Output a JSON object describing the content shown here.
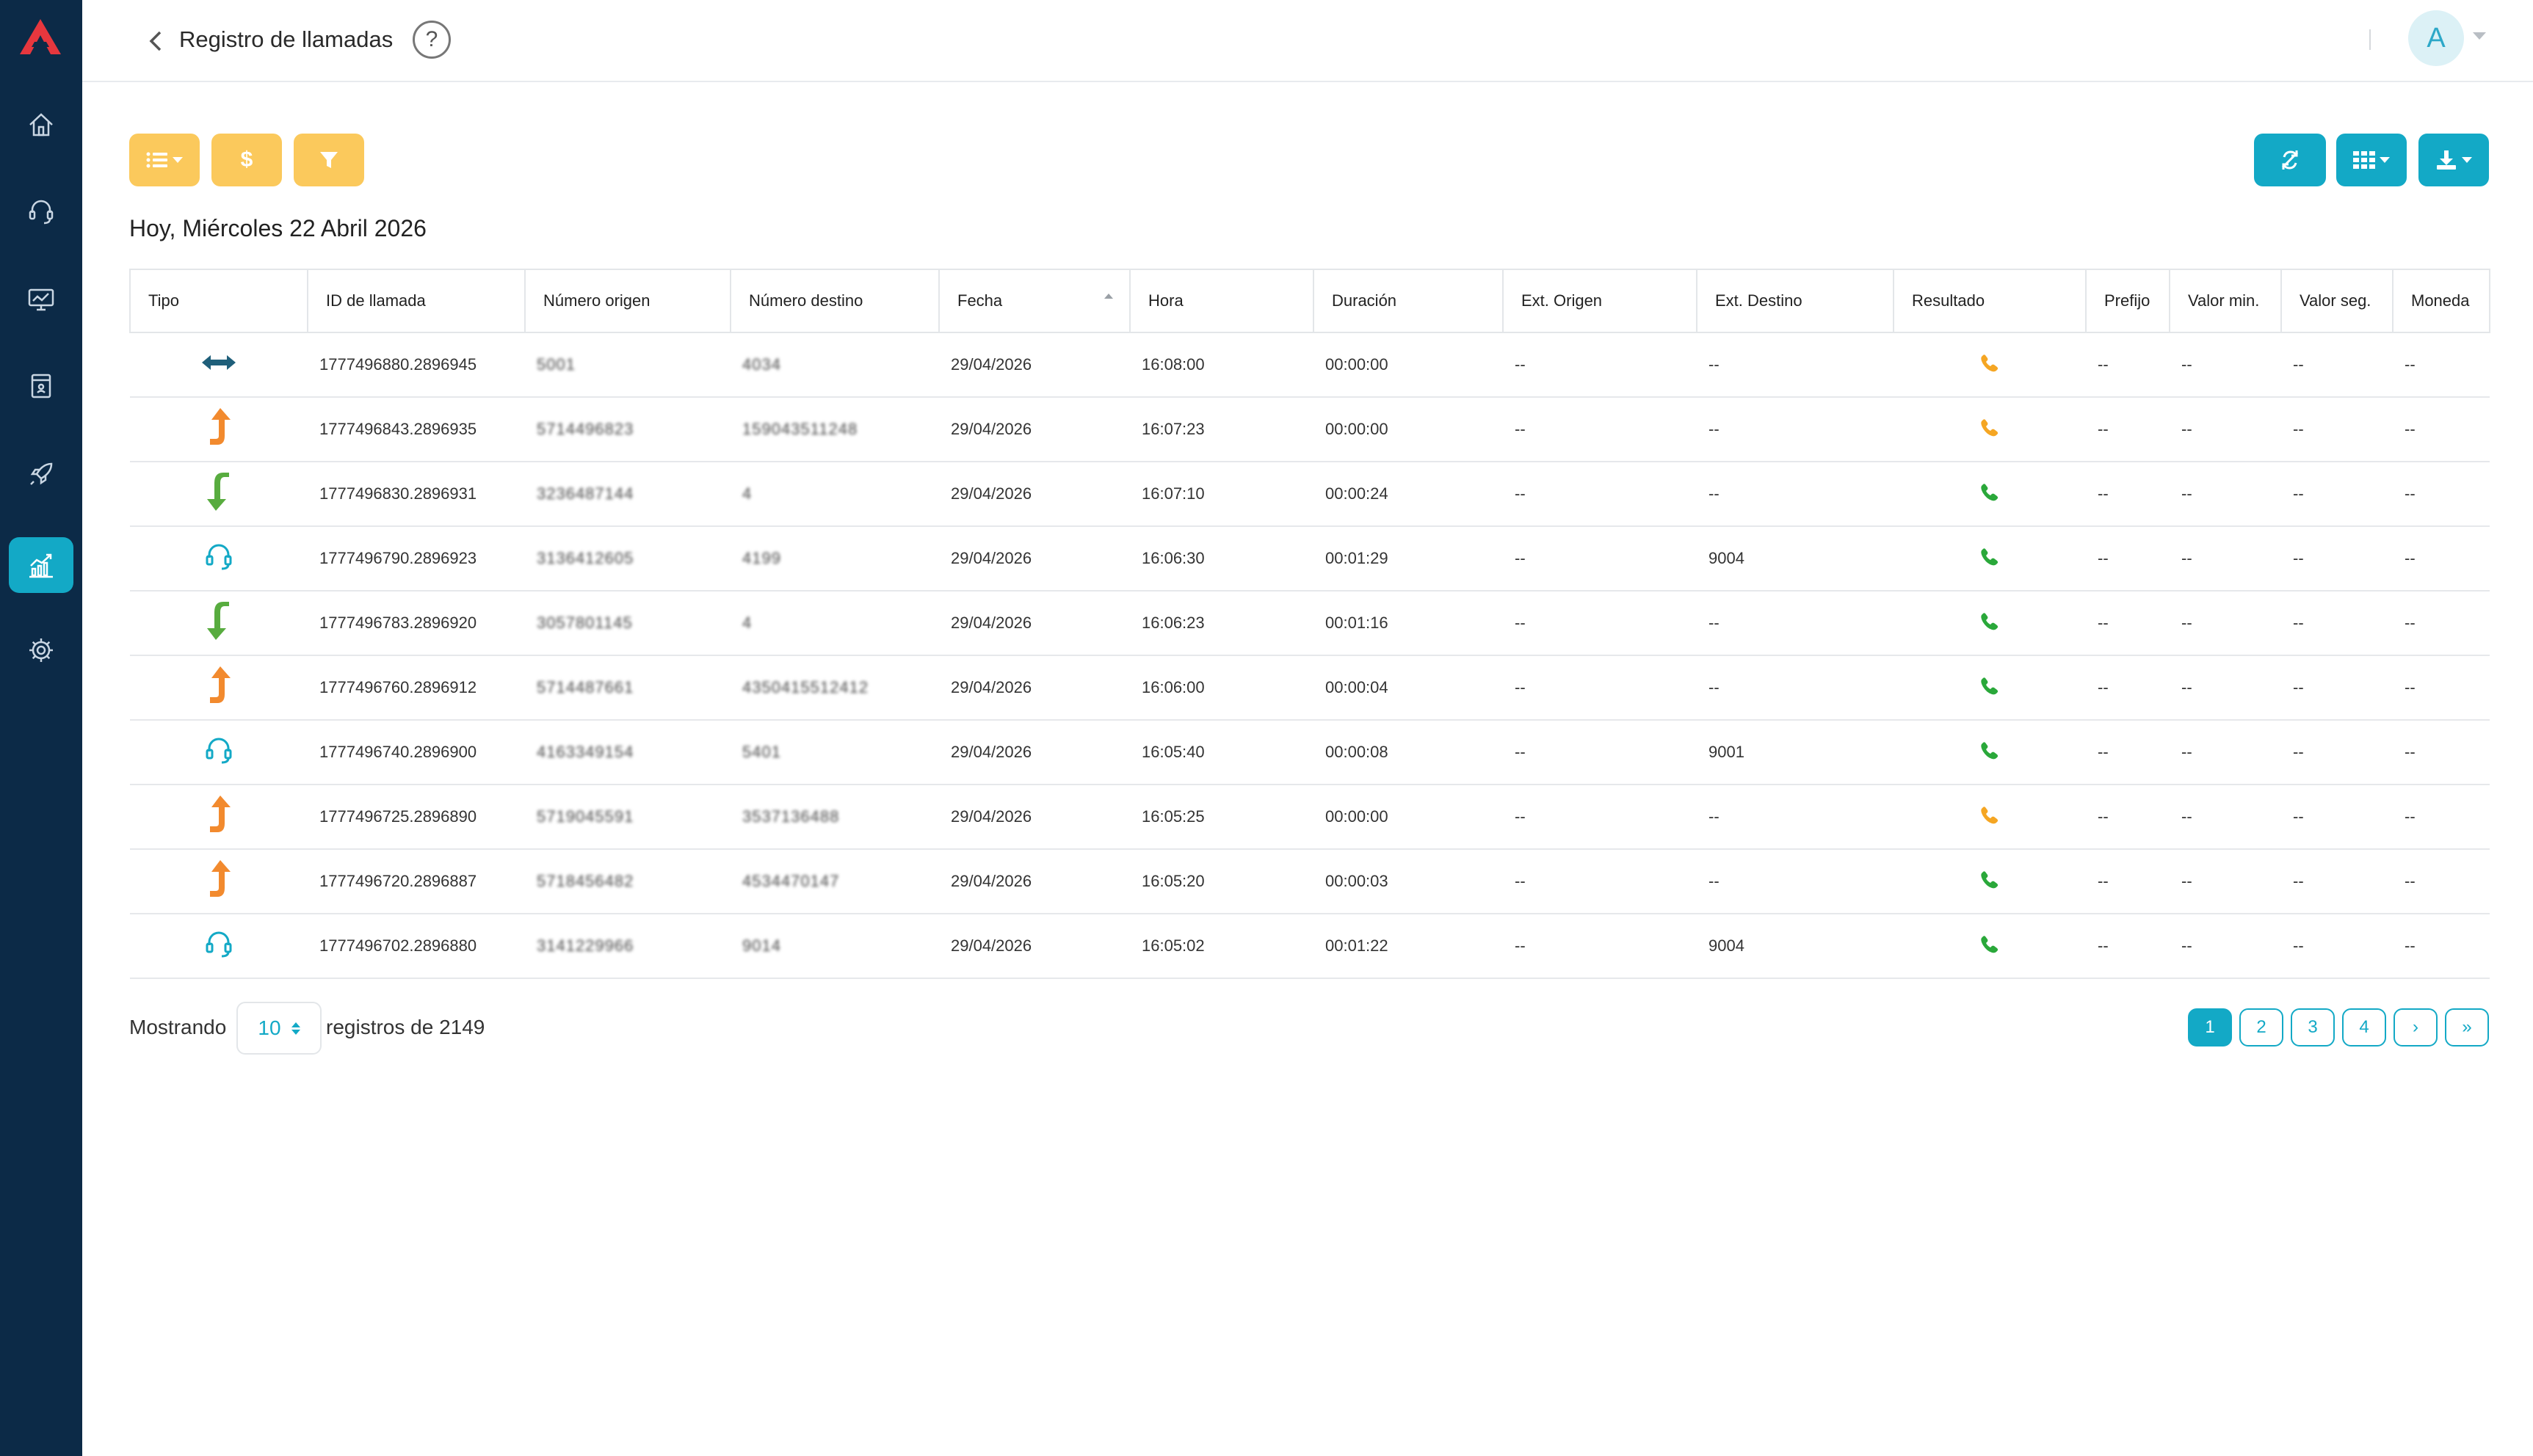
{
  "topbar": {
    "title": "Registro de llamadas",
    "help": "?",
    "avatar": "A"
  },
  "heading": "Hoy, Miércoles 22 Abril 2026",
  "colors": {
    "sidebar": "#0c2a47",
    "accent": "#13a9c6",
    "yellow": "#fbc95c",
    "orange": "#f28a2e",
    "green": "#58ac3f",
    "phone_green": "#2aa83a",
    "phone_orange": "#f5a623"
  },
  "table": {
    "headers": [
      "Tipo",
      "ID de llamada",
      "Número origen",
      "Número destino",
      "Fecha",
      "Hora",
      "Duración",
      "Ext. Origen",
      "Ext. Destino",
      "Resultado",
      "Prefijo",
      "Valor min.",
      "Valor seg.",
      "Moneda"
    ],
    "rows": [
      {
        "type": "internal-transfer",
        "id": "1777496880.2896945",
        "origen": "5001",
        "destino": "4034",
        "fecha": "29/04/2026",
        "hora": "16:08:00",
        "duracion": "00:00:00",
        "ext_origen": "--",
        "ext_destino": "--",
        "resultado": "orange",
        "prefijo": "--",
        "valor_min": "--",
        "valor_seg": "--",
        "moneda": "--"
      },
      {
        "type": "outgoing",
        "id": "1777496843.2896935",
        "origen": "5714496823",
        "destino": "159043511248",
        "fecha": "29/04/2026",
        "hora": "16:07:23",
        "duracion": "00:00:00",
        "ext_origen": "--",
        "ext_destino": "--",
        "resultado": "orange",
        "prefijo": "--",
        "valor_min": "--",
        "valor_seg": "--",
        "moneda": "--"
      },
      {
        "type": "incoming",
        "id": "1777496830.2896931",
        "origen": "3236487144",
        "destino": "4",
        "fecha": "29/04/2026",
        "hora": "16:07:10",
        "duracion": "00:00:24",
        "ext_origen": "--",
        "ext_destino": "--",
        "resultado": "green",
        "prefijo": "--",
        "valor_min": "--",
        "valor_seg": "--",
        "moneda": "--"
      },
      {
        "type": "agent",
        "id": "1777496790.2896923",
        "origen": "3136412605",
        "destino": "4199",
        "fecha": "29/04/2026",
        "hora": "16:06:30",
        "duracion": "00:01:29",
        "ext_origen": "--",
        "ext_destino": "9004",
        "resultado": "green",
        "prefijo": "--",
        "valor_min": "--",
        "valor_seg": "--",
        "moneda": "--"
      },
      {
        "type": "incoming",
        "id": "1777496783.2896920",
        "origen": "3057801145",
        "destino": "4",
        "fecha": "29/04/2026",
        "hora": "16:06:23",
        "duracion": "00:01:16",
        "ext_origen": "--",
        "ext_destino": "--",
        "resultado": "green",
        "prefijo": "--",
        "valor_min": "--",
        "valor_seg": "--",
        "moneda": "--"
      },
      {
        "type": "outgoing",
        "id": "1777496760.2896912",
        "origen": "5714487661",
        "destino": "4350415512412",
        "fecha": "29/04/2026",
        "hora": "16:06:00",
        "duracion": "00:00:04",
        "ext_origen": "--",
        "ext_destino": "--",
        "resultado": "green",
        "prefijo": "--",
        "valor_min": "--",
        "valor_seg": "--",
        "moneda": "--"
      },
      {
        "type": "agent",
        "id": "1777496740.2896900",
        "origen": "4163349154",
        "destino": "5401",
        "fecha": "29/04/2026",
        "hora": "16:05:40",
        "duracion": "00:00:08",
        "ext_origen": "--",
        "ext_destino": "9001",
        "resultado": "green",
        "prefijo": "--",
        "valor_min": "--",
        "valor_seg": "--",
        "moneda": "--"
      },
      {
        "type": "outgoing",
        "id": "1777496725.2896890",
        "origen": "5719045591",
        "destino": "3537136488",
        "fecha": "29/04/2026",
        "hora": "16:05:25",
        "duracion": "00:00:00",
        "ext_origen": "--",
        "ext_destino": "--",
        "resultado": "orange",
        "prefijo": "--",
        "valor_min": "--",
        "valor_seg": "--",
        "moneda": "--"
      },
      {
        "type": "outgoing",
        "id": "1777496720.2896887",
        "origen": "5718456482",
        "destino": "4534470147",
        "fecha": "29/04/2026",
        "hora": "16:05:20",
        "duracion": "00:00:03",
        "ext_origen": "--",
        "ext_destino": "--",
        "resultado": "green",
        "prefijo": "--",
        "valor_min": "--",
        "valor_seg": "--",
        "moneda": "--"
      },
      {
        "type": "agent",
        "id": "1777496702.2896880",
        "origen": "3141229966",
        "destino": "9014",
        "fecha": "29/04/2026",
        "hora": "16:05:02",
        "duracion": "00:01:22",
        "ext_origen": "--",
        "ext_destino": "9004",
        "resultado": "green",
        "prefijo": "--",
        "valor_min": "--",
        "valor_seg": "--",
        "moneda": "--"
      }
    ]
  },
  "footer": {
    "showing": "Mostrando",
    "page_size": "10",
    "total": "registros de 2149"
  },
  "pagination": [
    "1",
    "2",
    "3",
    "4",
    "›",
    "»"
  ]
}
